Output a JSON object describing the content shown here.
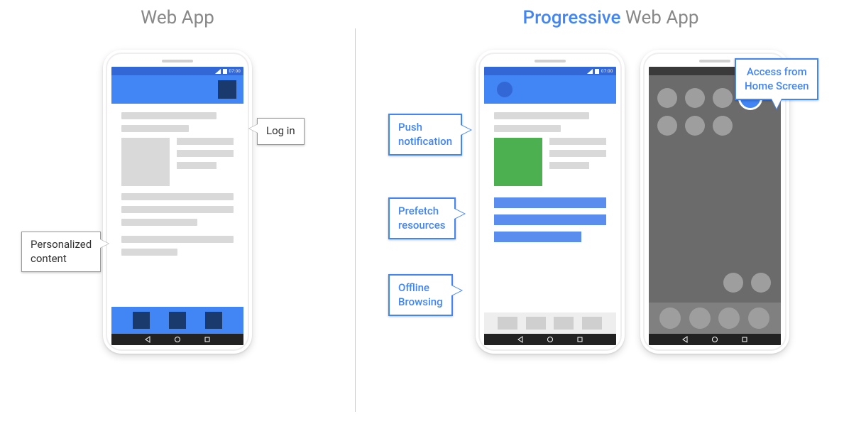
{
  "left": {
    "title": "Web App",
    "callouts": {
      "login": "Log in",
      "personalized": "Personalized\ncontent"
    },
    "statusbar_time": "07:00"
  },
  "right": {
    "title_accent": "Progressive",
    "title_rest": " Web App",
    "callouts": {
      "push": "Push\nnotification",
      "prefetch": "Prefetch\nresources",
      "offline": "Offline\nBrowsing",
      "access": "Access from\nHome Screen"
    },
    "statusbar_time": "07:00"
  }
}
